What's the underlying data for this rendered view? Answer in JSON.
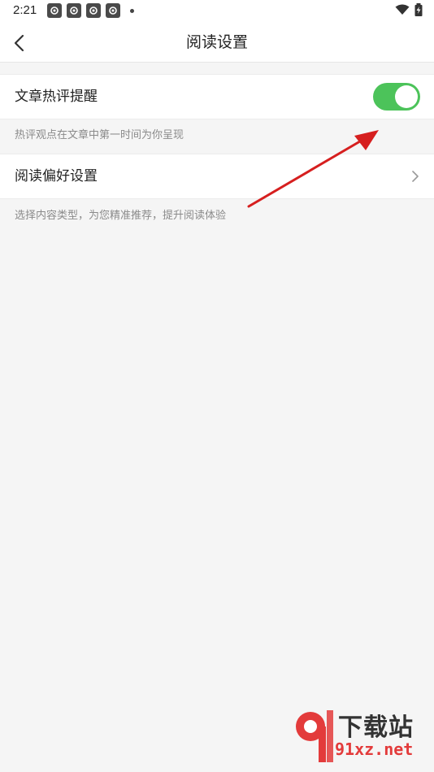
{
  "status_bar": {
    "time": "2:21",
    "notification_icons": [
      "app-notif-icon",
      "app-notif-icon",
      "app-notif-icon",
      "app-notif-icon"
    ]
  },
  "header": {
    "title": "阅读设置",
    "back_icon": "chevron-left-icon"
  },
  "settings": [
    {
      "label": "文章热评提醒",
      "hint": "热评观点在文章中第一时间为你呈现",
      "control": "toggle",
      "enabled": true
    },
    {
      "label": "阅读偏好设置",
      "hint": "选择内容类型，为您精准推荐，提升阅读体验",
      "control": "chevron"
    }
  ],
  "colors": {
    "toggle_on": "#4cc35a",
    "annotation_arrow": "#d61f1f",
    "background": "#f5f5f5"
  },
  "watermark": {
    "brand_top": "下载站",
    "brand_bottom": "91xz.net"
  }
}
